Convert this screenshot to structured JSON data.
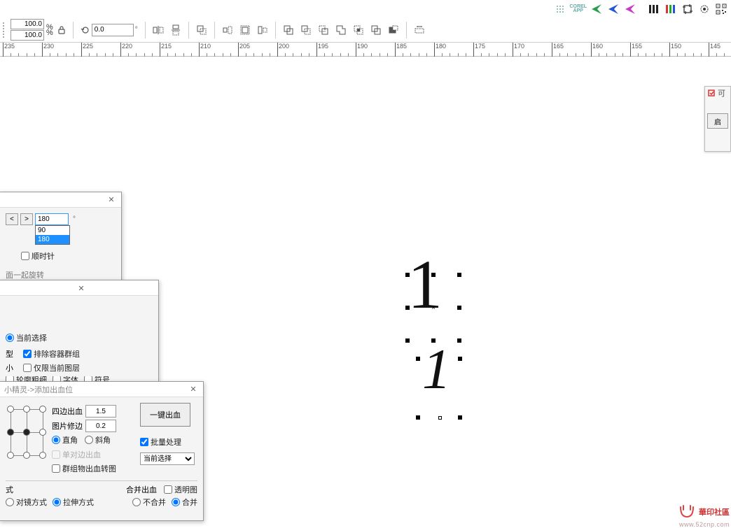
{
  "topstrip": {
    "corelapp": "COREL\nAPP"
  },
  "propbar": {
    "scale_x": "100.0",
    "scale_y": "100.0",
    "pct": "%",
    "rotation": "0.0",
    "rot_unit": "°"
  },
  "ruler": {
    "start": 235,
    "step": -5,
    "count": 30,
    "labels": [
      235,
      230,
      225,
      220,
      215,
      210,
      205,
      200,
      195,
      190,
      185,
      180,
      175,
      170,
      165,
      160,
      155,
      150,
      145
    ]
  },
  "right_panel": {
    "title": "可",
    "button": "启"
  },
  "dlg_rotate": {
    "nav_prev": "<",
    "nav_next": ">",
    "angle_value": "180",
    "angle_unit": "°",
    "options": [
      "90",
      "180"
    ],
    "clockwise": "顺时针",
    "with_page": "面一起旋转",
    "current_sel": "当前选择",
    "type_suffix": "型",
    "exclude_container": "排除容器群组",
    "size_suffix": "小",
    "only_current_layer": "仅限当前图层",
    "bottom_frag1": "轮廓粗细",
    "bottom_frag2": "字体",
    "bottom_frag3": "符号"
  },
  "dlg_bleed": {
    "title": "小精灵->添加出血位",
    "four_sides": "四边出血",
    "four_sides_val": "1.5",
    "image_trim": "图片修边",
    "image_trim_val": "0.2",
    "corner_right": "直角",
    "corner_bevel": "斜角",
    "single_side": "单对边出血",
    "group_to_img": "群组物出血转图",
    "one_click": "一键出血",
    "batch": "批量处理",
    "scope": "当前选择",
    "mode_suffix": "式",
    "mirror_mode": "对镜方式",
    "stretch_mode": "拉伸方式",
    "merge_bleed": "合并出血",
    "trans_img": "透明图",
    "no_merge": "不合并",
    "do_merge": "合并"
  },
  "canvas": {
    "obj_text": "1"
  },
  "watermark": {
    "text": "華印社區",
    "url": "www.52cnp.com"
  }
}
